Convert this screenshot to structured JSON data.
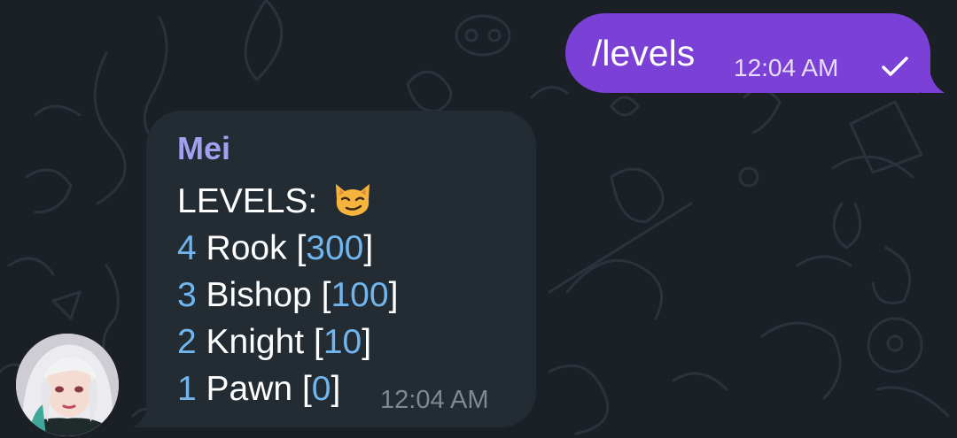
{
  "chat": {
    "outgoing": {
      "text": "/levels",
      "time": "12:04 AM",
      "status_icon": "check-icon",
      "bubble_color": "#7b40d6"
    },
    "incoming": {
      "sender": "Mei",
      "title": "LEVELS:",
      "title_emoji": "smirking-cat-emoji",
      "levels": [
        {
          "num": "4",
          "name": "Rook",
          "value": "300"
        },
        {
          "num": "3",
          "name": "Bishop",
          "value": "100"
        },
        {
          "num": "2",
          "name": "Knight",
          "value": "10"
        },
        {
          "num": "1",
          "name": "Pawn",
          "value": "0"
        }
      ],
      "time": "12:04 AM",
      "bubble_color": "#232b33",
      "accent_color": "#71b5ef",
      "sender_color": "#a29ff0"
    },
    "avatar": "bot-avatar"
  }
}
